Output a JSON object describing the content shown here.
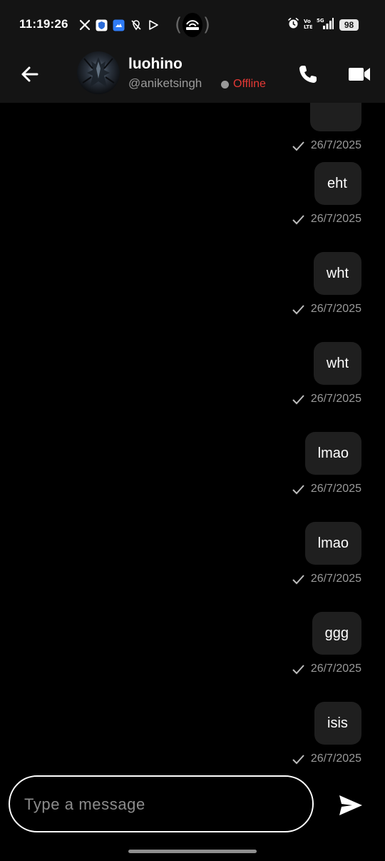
{
  "status_bar": {
    "time": "11:19:26",
    "battery": "98",
    "left_icons": [
      "x-icon",
      "shield-app-icon",
      "cloud-app-icon",
      "location-off-icon",
      "play-store-icon"
    ],
    "right_icons": [
      "alarm-icon",
      "volte-icon",
      "5g-signal-icon"
    ]
  },
  "header": {
    "contact_name": "luohino",
    "contact_handle": "@aniketsingh",
    "presence": "Offline",
    "presence_color": "#e53935"
  },
  "messages": [
    {
      "text": "",
      "date": "26/7/2025",
      "partial": true
    },
    {
      "text": "eht",
      "date": "26/7/2025"
    },
    {
      "text": "wht",
      "date": "26/7/2025"
    },
    {
      "text": "wht",
      "date": "26/7/2025"
    },
    {
      "text": "lmao",
      "date": "26/7/2025"
    },
    {
      "text": "lmao",
      "date": "26/7/2025"
    },
    {
      "text": "ggg",
      "date": "26/7/2025"
    },
    {
      "text": "isis",
      "date": "26/7/2025"
    }
  ],
  "composer": {
    "placeholder": "Type a message",
    "value": ""
  },
  "colors": {
    "background": "#000000",
    "header_bg": "#141414",
    "bubble_bg": "#1f1f1f",
    "meta_text": "#9a9a9a"
  }
}
